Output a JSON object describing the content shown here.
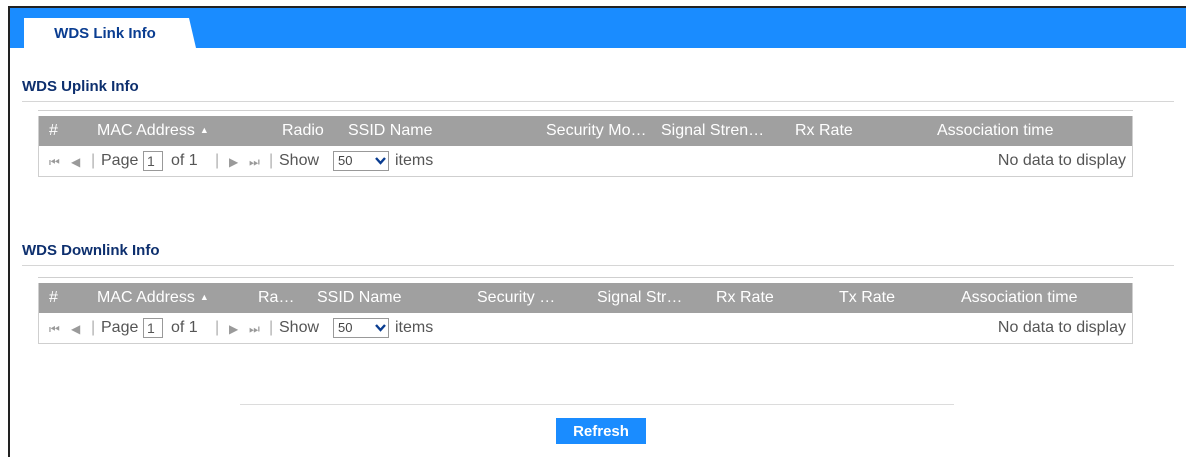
{
  "tabs": [
    {
      "label": "WDS Link Info",
      "active": true
    }
  ],
  "uplink": {
    "title": "WDS Uplink Info",
    "columns": [
      "#",
      "MAC Address",
      "Radio",
      "SSID Name",
      "Security Mo…",
      "Signal Stren…",
      "Rx Rate",
      "Association time"
    ],
    "pager": {
      "page_label": "Page",
      "page_value": "1",
      "of_label": "of 1",
      "show_label": "Show",
      "show_value": "50",
      "items_label": "items",
      "no_data": "No data to display"
    }
  },
  "downlink": {
    "title": "WDS Downlink Info",
    "columns": [
      "#",
      "MAC Address",
      "Ra…",
      "SSID Name",
      "Security …",
      "Signal Str…",
      "Rx Rate",
      "Tx Rate",
      "Association time"
    ],
    "pager": {
      "page_label": "Page",
      "page_value": "1",
      "of_label": "of 1",
      "show_label": "Show",
      "show_value": "50",
      "items_label": "items",
      "no_data": "No data to display"
    }
  },
  "refresh_label": "Refresh",
  "colors": {
    "accent": "#1a8cff",
    "tab_text": "#0a3d91",
    "section_title": "#0d2f6e",
    "grid_header": "#a0a0a0"
  },
  "icons": {
    "sort": "sort-ascending-icon",
    "first": "first-page-icon",
    "prev": "prev-page-icon",
    "next": "next-page-icon",
    "last": "last-page-icon",
    "dropdown": "chevron-down-icon"
  }
}
